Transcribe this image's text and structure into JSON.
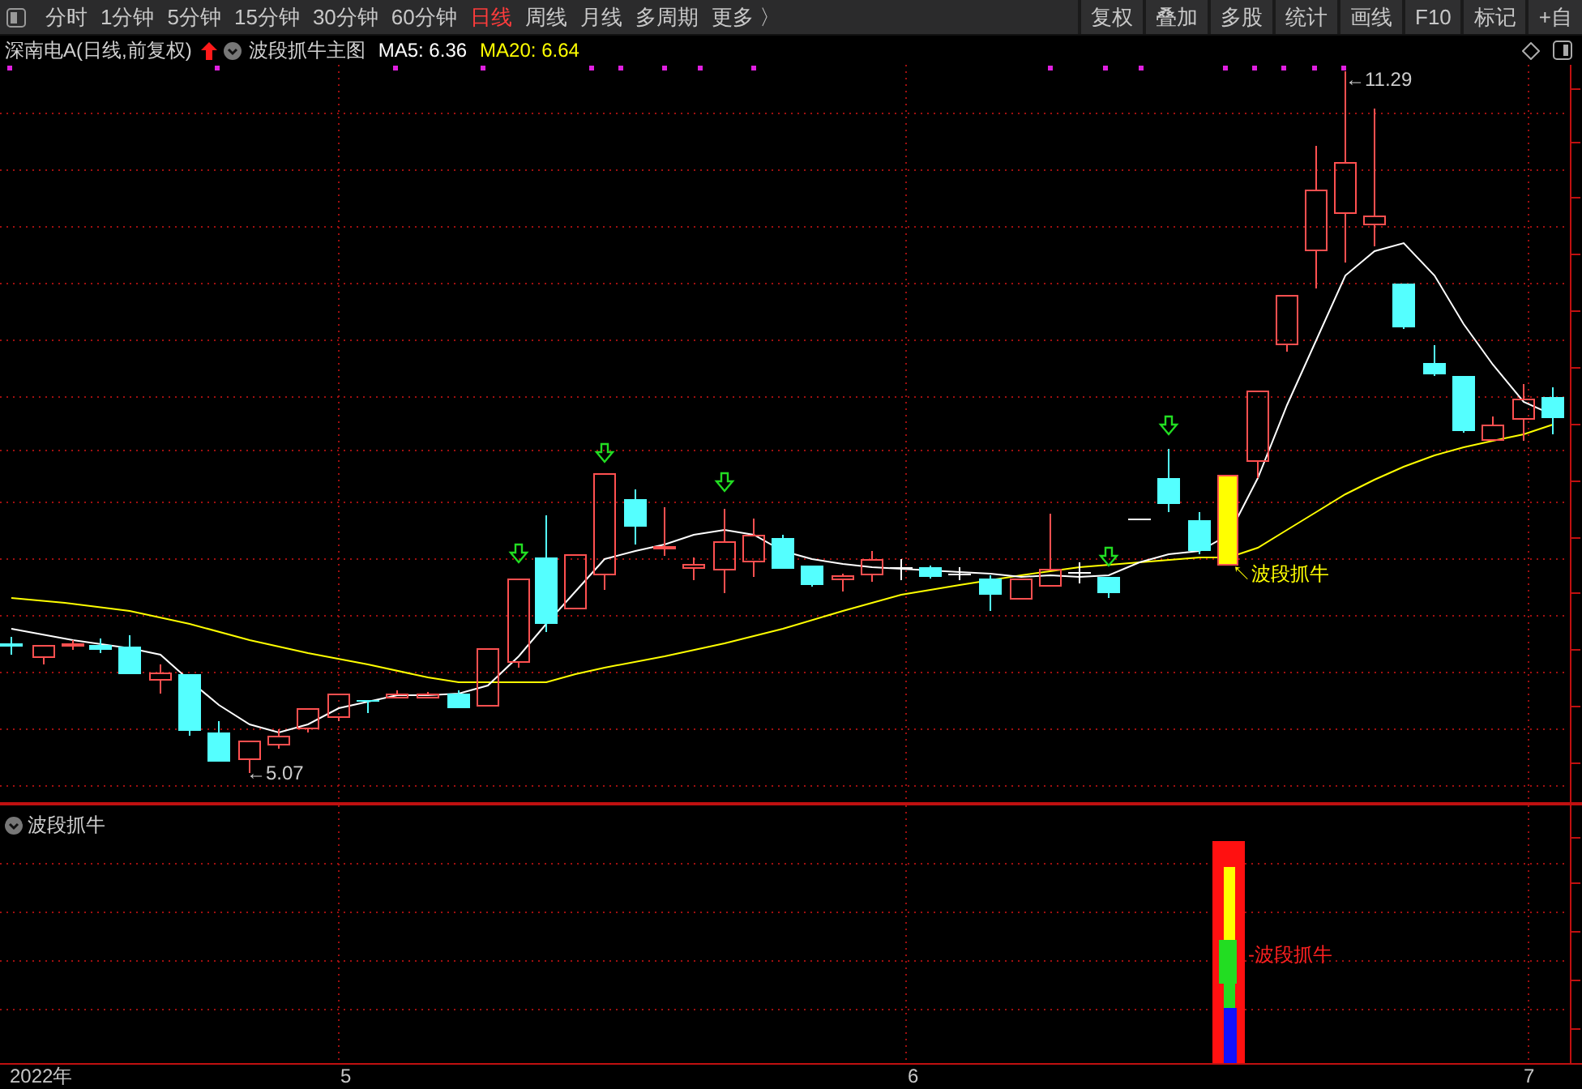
{
  "toolbar": {
    "periods": [
      {
        "label": "分时",
        "selected": false
      },
      {
        "label": "1分钟",
        "selected": false
      },
      {
        "label": "5分钟",
        "selected": false
      },
      {
        "label": "15分钟",
        "selected": false
      },
      {
        "label": "30分钟",
        "selected": false
      },
      {
        "label": "60分钟",
        "selected": false
      },
      {
        "label": "日线",
        "selected": true
      },
      {
        "label": "周线",
        "selected": false
      },
      {
        "label": "月线",
        "selected": false
      },
      {
        "label": "多周期",
        "selected": false
      },
      {
        "label": "更多 〉",
        "selected": false
      }
    ],
    "buttons": [
      "复权",
      "叠加",
      "多股",
      "统计",
      "画线",
      "F10",
      "标记",
      "+自"
    ]
  },
  "info_bar": {
    "title": "深南电A(日线,前复权)",
    "indicator": "波段抓牛主图",
    "ma": [
      {
        "label": "MA5: 6.36",
        "color": "#ffffff"
      },
      {
        "label": "MA20: 6.64",
        "color": "#ffff00"
      }
    ]
  },
  "main_chart": {
    "high_label": "←11.29",
    "low_label": "←5.07",
    "signal_label": "↖波段抓牛"
  },
  "lower_panel": {
    "title": "波段抓牛",
    "signal_label": "-波段抓牛"
  },
  "x_axis": [
    "2022年",
    "5",
    "6",
    "7"
  ]
}
